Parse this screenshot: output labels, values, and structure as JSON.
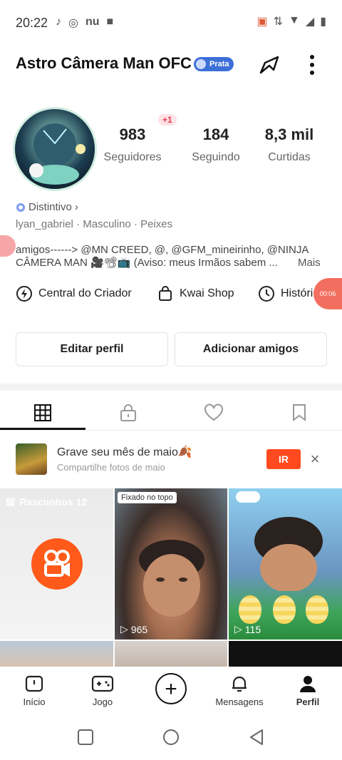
{
  "status_bar": {
    "time": "20:22",
    "left_icons": [
      "tiktok-icon",
      "chrome-icon",
      "nu-icon",
      "video-camera-icon"
    ],
    "right_icons": [
      "cast-icon",
      "data-arrows-icon",
      "wifi-icon",
      "signal-icon",
      "battery-icon"
    ]
  },
  "header": {
    "name": "Astro Câmera Man OFC",
    "badge_label": "Prata"
  },
  "stats": {
    "followers_value": "983",
    "followers_label": "Seguidores",
    "followers_delta": "+1",
    "following_value": "184",
    "following_label": "Seguindo",
    "likes_value": "8,3 mil",
    "likes_label": "Curtidas"
  },
  "profile": {
    "distintivo": "Distintivo",
    "username": "lyan_gabriel",
    "gender": "Masculino",
    "sign": "Peixes",
    "bio_line1": "amigos------> @MN CREED, @, @GFM_mineirinho, @NINJA",
    "bio_line2": "CÂMERA MAN 🎥📽📺 (Aviso: meus Irmãos sabem ...",
    "bio_more": "Mais"
  },
  "shortcuts": {
    "creator": "Central do Criador",
    "shop": "Kwai Shop",
    "history": "Histórico de"
  },
  "floating": {
    "timer": "00:06"
  },
  "actions": {
    "edit": "Editar perfil",
    "add_friends": "Adicionar amigos"
  },
  "tabs": [
    "grid-icon",
    "lock-icon",
    "heart-icon",
    "bookmark-icon"
  ],
  "promo": {
    "title": "Grave seu mês de maio🍂",
    "subtitle": "Compartilhe fotos de maio",
    "cta": "IR"
  },
  "grid": {
    "drafts_label": "Rascunhos 12",
    "pinned_label": "Fixado no topo",
    "video1_plays": "965",
    "video2_plays": "115"
  },
  "bottom_nav": {
    "home": "Início",
    "game": "Jogo",
    "messages": "Mensagens",
    "profile": "Perfil"
  },
  "colors": {
    "accent": "#ff4a1f",
    "badge": "#3c6fd8",
    "kwai": "#ff5a1a"
  }
}
